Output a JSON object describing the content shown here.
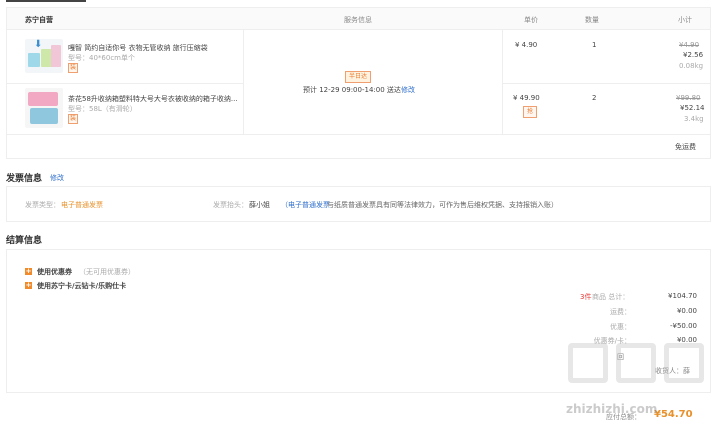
{
  "store": {
    "name": "苏宁自营",
    "col_service": "服务信息",
    "col_price": "单价",
    "col_qty": "数量",
    "col_subtotal": "小计"
  },
  "items": [
    {
      "name": "嘎智 简约自适你号 衣物无管收纳 旅行压缩袋",
      "spec": "型号：40*60cm单个",
      "badge": "装",
      "price": "¥ 4.90",
      "qty": "1",
      "orig": "¥4.90",
      "subtotal": "¥2.56",
      "weight": "0.08kg"
    },
    {
      "name": "茶花58升收纳箱塑料特大号大号衣被收纳的箱子收纳...",
      "spec": "型号：58L（有滑轮）",
      "badge": "装",
      "price": "¥ 49.90",
      "promo": "抢",
      "qty": "2",
      "orig": "¥99.80",
      "subtotal": "¥52.14",
      "weight": "3.4kg"
    }
  ],
  "service": {
    "badge": "半日达",
    "delivery": "预计 12-29 09:00-14:00 送达",
    "edit": "修改"
  },
  "shipping": "免运费",
  "invoice": {
    "title": "发票信息",
    "edit": "修改",
    "type_label": "发票类型：",
    "type_value": "电子普通发票",
    "head_label": "发票抬头：",
    "head_value": "薛小姐",
    "note_link": "（电子普通发票",
    "note_text": "与纸质普通发票具有同等法律效力，可作为售后维权凭据、支持报销入账）"
  },
  "settlement": {
    "title": "结算信息",
    "coupon_label": "使用优惠券",
    "coupon_note": "（无可用优惠券）",
    "card_label": "使用苏宁卡/云钻卡/乐购仕卡",
    "summary": [
      {
        "label_prefix": "3件",
        "label": "商品 总计：",
        "value": "¥104.70"
      },
      {
        "label": "运费：",
        "value": "¥0.00"
      },
      {
        "label": "优惠：",
        "value": "-¥50.00"
      },
      {
        "label": "优惠券/卡：",
        "value": "¥0.00"
      }
    ],
    "address_fragment": "回",
    "recipient_fragment": "收货人：薛",
    "pay_label": "应付总额：",
    "pay_value": "¥54.70"
  },
  "watermark": {
    "text": "zhizhizhi.com"
  },
  "colors": {
    "accent": "#e8912a",
    "link": "#2e6ecc",
    "price_red": "#e53935"
  }
}
